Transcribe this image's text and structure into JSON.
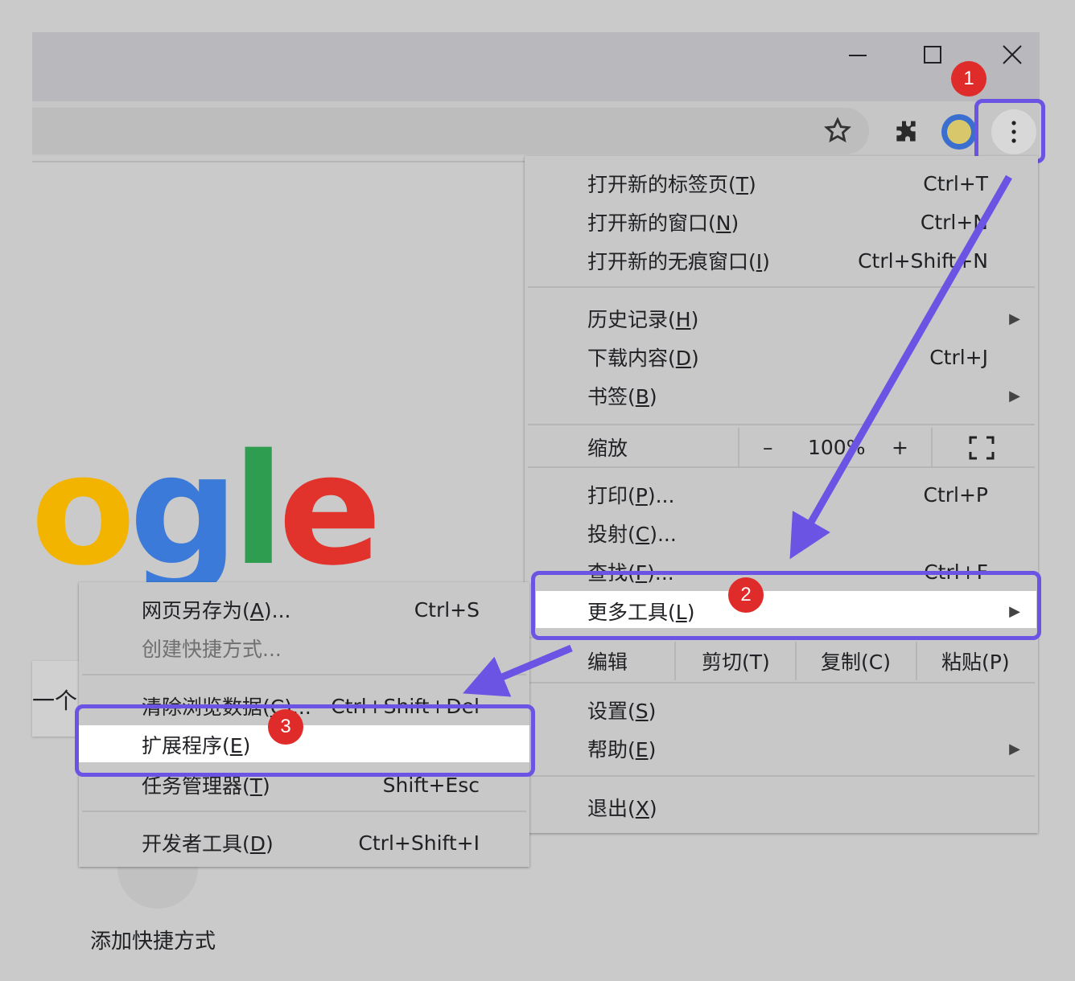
{
  "window": {
    "minimize_icon": "minimize-icon",
    "maximize_icon": "maximize-icon",
    "close_icon": "close-icon"
  },
  "toolbar": {
    "star_icon": "star-icon",
    "extensions_icon": "puzzle-icon",
    "profile_icon": "avatar",
    "menu_icon": "kebab-menu-icon"
  },
  "logo_letters": [
    "o",
    "g",
    "l",
    "e"
  ],
  "main_menu": {
    "new_tab": "打开新的标签页(",
    "new_tab_key": "T",
    "new_tab_sc": "Ctrl+T",
    "new_window": "打开新的窗口(",
    "new_window_key": "N",
    "new_window_sc": "Ctrl+N",
    "incognito": "打开新的无痕窗口(",
    "incognito_key": "I",
    "incognito_sc": "Ctrl+Shift+N",
    "history": "历史记录(",
    "history_key": "H",
    "downloads": "下载内容(",
    "downloads_key": "D",
    "downloads_sc": "Ctrl+J",
    "bookmarks": "书签(",
    "bookmarks_key": "B",
    "zoom": "缩放",
    "zoom_minus": "–",
    "zoom_value": "100%",
    "zoom_plus": "+",
    "print": "打印(",
    "print_key": "P",
    "print_sc": "Ctrl+P",
    "cast": "投射(",
    "cast_key": "C",
    "find": "查找(",
    "find_key": "F",
    "find_sc": "Ctrl+F",
    "more_tools": "更多工具(",
    "more_tools_key": "L",
    "edit": "编辑",
    "cut": "剪切(T)",
    "copy": "复制(C)",
    "paste": "粘贴(P)",
    "settings": "设置(",
    "settings_key": "S",
    "help": "帮助(",
    "help_key": "E",
    "exit": "退出(",
    "exit_key": "X"
  },
  "sub_menu": {
    "save_page": "网页另存为(",
    "save_page_key": "A",
    "save_page_sc": "Ctrl+S",
    "create_shortcut": "创建快捷方式...",
    "clear_data": "清除浏览数据(",
    "clear_data_key": "C",
    "clear_data_sc": "Ctrl+Shift+Del",
    "extensions": "扩展程序(",
    "extensions_key": "E",
    "task_manager": "任务管理器(",
    "task_manager_key": "T",
    "task_manager_sc": "Shift+Esc",
    "dev_tools": "开发者工具(",
    "dev_tools_key": "D",
    "dev_tools_sc": "Ctrl+Shift+I"
  },
  "annotations": {
    "step1": "1",
    "step2": "2",
    "step3": "3",
    "accent": "#6b54e4",
    "badge_color": "#e02b2b"
  },
  "page": {
    "partial_card": "一个",
    "add_shortcut": "添加快捷方式"
  }
}
